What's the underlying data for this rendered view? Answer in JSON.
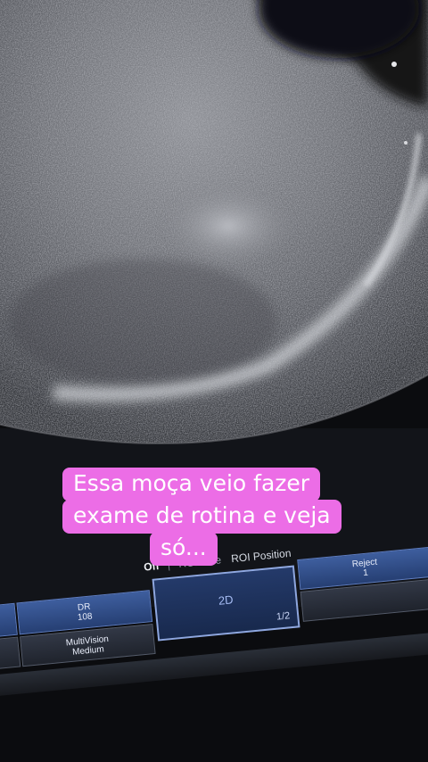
{
  "caption": {
    "lines": [
      "Essa moça veio fazer",
      "exame de rotina e veja",
      "só..."
    ],
    "background": "#ec6de6",
    "text_color": "#ffffff"
  },
  "roi_bar": {
    "off_label": "Off",
    "separator": "|",
    "roi_size_label": "ROI Size",
    "roi_position_label": "ROI Position"
  },
  "buttons": {
    "dr": {
      "label": "DR",
      "value": "108"
    },
    "multivision": {
      "label": "MultiVision",
      "value": "Medium"
    },
    "mode_2d": {
      "label": "2D",
      "page": "1/2"
    },
    "reject": {
      "label": "Reject",
      "value": "1"
    }
  },
  "colors": {
    "button_blue": "#3e5e9e",
    "button_border": "#5d7cc0",
    "active_outline": "#8ea7e0",
    "scan_background": "#0b0c0f"
  }
}
